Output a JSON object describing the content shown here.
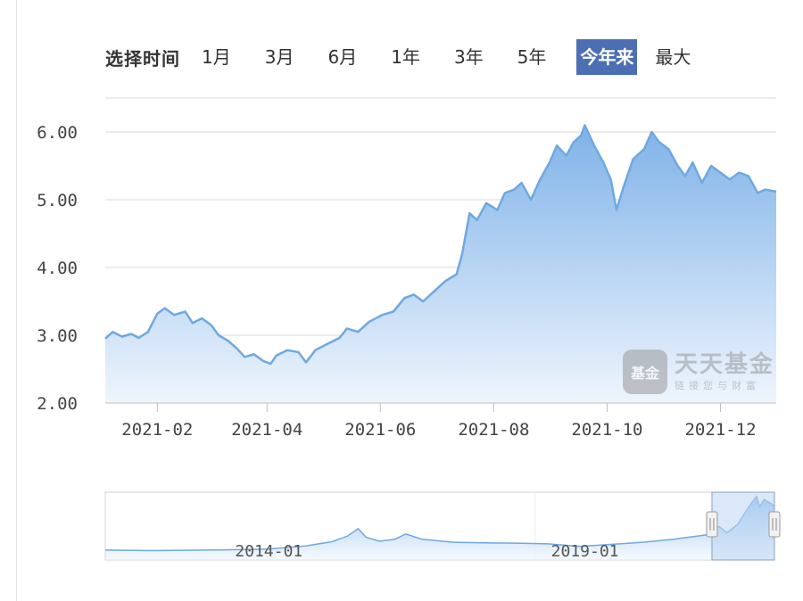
{
  "range_selector": {
    "label": "选择时间",
    "options": [
      {
        "id": "1m",
        "label": "1月"
      },
      {
        "id": "3m",
        "label": "3月"
      },
      {
        "id": "6m",
        "label": "6月"
      },
      {
        "id": "1y",
        "label": "1年"
      },
      {
        "id": "3y",
        "label": "3年"
      },
      {
        "id": "5y",
        "label": "5年"
      },
      {
        "id": "ytd",
        "label": "今年来"
      },
      {
        "id": "max",
        "label": "最大"
      }
    ],
    "active": "ytd"
  },
  "watermark": {
    "logo_text": "基金",
    "name": "天天基金",
    "slogan": "链接您与财富"
  },
  "colors": {
    "line": "#6fa8e0",
    "fill_top": "#7fb2e8",
    "fill_bottom": "#eef5fd",
    "active_btn": "#4c6fb3",
    "grid": "#d9d9d9"
  },
  "chart_data": {
    "type": "area",
    "title": "",
    "xlabel": "",
    "ylabel": "",
    "ylim": [
      2.0,
      6.5
    ],
    "yticks": [
      2.0,
      3.0,
      4.0,
      5.0,
      6.0
    ],
    "ytick_labels": [
      "2.00",
      "3.00",
      "4.00",
      "5.00",
      "6.00"
    ],
    "xlim": [
      "2021-01-04",
      "2021-12-31"
    ],
    "xticks": [
      "2021-02-01",
      "2021-04-01",
      "2021-06-01",
      "2021-08-01",
      "2021-10-01",
      "2021-12-01"
    ],
    "xtick_labels": [
      "2021-02",
      "2021-04",
      "2021-06",
      "2021-08",
      "2021-10",
      "2021-12"
    ],
    "grid": true,
    "series": [
      {
        "points": [
          [
            "2021-01-04",
            2.95
          ],
          [
            "2021-01-08",
            3.05
          ],
          [
            "2021-01-13",
            2.98
          ],
          [
            "2021-01-18",
            3.02
          ],
          [
            "2021-01-22",
            2.96
          ],
          [
            "2021-01-27",
            3.05
          ],
          [
            "2021-02-01",
            3.32
          ],
          [
            "2021-02-05",
            3.4
          ],
          [
            "2021-02-10",
            3.3
          ],
          [
            "2021-02-16",
            3.35
          ],
          [
            "2021-02-20",
            3.18
          ],
          [
            "2021-02-25",
            3.25
          ],
          [
            "2021-03-02",
            3.15
          ],
          [
            "2021-03-06",
            3.0
          ],
          [
            "2021-03-11",
            2.92
          ],
          [
            "2021-03-16",
            2.8
          ],
          [
            "2021-03-20",
            2.68
          ],
          [
            "2021-03-25",
            2.72
          ],
          [
            "2021-03-30",
            2.62
          ],
          [
            "2021-04-03",
            2.58
          ],
          [
            "2021-04-06",
            2.7
          ],
          [
            "2021-04-12",
            2.78
          ],
          [
            "2021-04-18",
            2.75
          ],
          [
            "2021-04-22",
            2.6
          ],
          [
            "2021-04-27",
            2.78
          ],
          [
            "2021-05-04",
            2.88
          ],
          [
            "2021-05-10",
            2.96
          ],
          [
            "2021-05-14",
            3.1
          ],
          [
            "2021-05-20",
            3.05
          ],
          [
            "2021-05-26",
            3.2
          ],
          [
            "2021-06-02",
            3.3
          ],
          [
            "2021-06-08",
            3.35
          ],
          [
            "2021-06-14",
            3.55
          ],
          [
            "2021-06-19",
            3.6
          ],
          [
            "2021-06-24",
            3.5
          ],
          [
            "2021-06-30",
            3.65
          ],
          [
            "2021-07-06",
            3.8
          ],
          [
            "2021-07-12",
            3.9
          ],
          [
            "2021-07-15",
            4.2
          ],
          [
            "2021-07-19",
            4.8
          ],
          [
            "2021-07-23",
            4.7
          ],
          [
            "2021-07-28",
            4.95
          ],
          [
            "2021-08-03",
            4.85
          ],
          [
            "2021-08-07",
            5.1
          ],
          [
            "2021-08-12",
            5.15
          ],
          [
            "2021-08-16",
            5.25
          ],
          [
            "2021-08-21",
            5.0
          ],
          [
            "2021-08-26",
            5.3
          ],
          [
            "2021-08-31",
            5.55
          ],
          [
            "2021-09-04",
            5.8
          ],
          [
            "2021-09-09",
            5.65
          ],
          [
            "2021-09-13",
            5.85
          ],
          [
            "2021-09-17",
            5.95
          ],
          [
            "2021-09-19",
            6.1
          ],
          [
            "2021-09-24",
            5.8
          ],
          [
            "2021-09-29",
            5.55
          ],
          [
            "2021-10-03",
            5.3
          ],
          [
            "2021-10-06",
            4.85
          ],
          [
            "2021-10-10",
            5.2
          ],
          [
            "2021-10-15",
            5.6
          ],
          [
            "2021-10-21",
            5.75
          ],
          [
            "2021-10-25",
            6.0
          ],
          [
            "2021-10-29",
            5.85
          ],
          [
            "2021-11-03",
            5.75
          ],
          [
            "2021-11-08",
            5.5
          ],
          [
            "2021-11-12",
            5.35
          ],
          [
            "2021-11-16",
            5.55
          ],
          [
            "2021-11-21",
            5.25
          ],
          [
            "2021-11-26",
            5.5
          ],
          [
            "2021-12-01",
            5.4
          ],
          [
            "2021-12-06",
            5.3
          ],
          [
            "2021-12-11",
            5.4
          ],
          [
            "2021-12-16",
            5.35
          ],
          [
            "2021-12-21",
            5.1
          ],
          [
            "2021-12-25",
            5.15
          ],
          [
            "2021-12-31",
            5.12
          ]
        ]
      }
    ],
    "navigator": {
      "xlim": [
        "2011-06-01",
        "2021-12-31"
      ],
      "ylim": [
        0.0,
        6.5
      ],
      "xtick_labels": [
        {
          "date": "2014-01-01",
          "label": "2014-01"
        },
        {
          "date": "2019-01-01",
          "label": "2019-01"
        }
      ],
      "selection": [
        "2021-01-04",
        "2021-12-31"
      ],
      "points": [
        [
          "2011-06-01",
          0.95
        ],
        [
          "2012-03-01",
          0.9
        ],
        [
          "2013-01-01",
          0.95
        ],
        [
          "2013-09-01",
          1.0
        ],
        [
          "2014-01-01",
          1.05
        ],
        [
          "2014-08-01",
          1.35
        ],
        [
          "2015-01-01",
          1.75
        ],
        [
          "2015-04-01",
          2.3
        ],
        [
          "2015-06-01",
          3.0
        ],
        [
          "2015-07-15",
          2.2
        ],
        [
          "2015-10-01",
          1.8
        ],
        [
          "2016-01-01",
          2.0
        ],
        [
          "2016-03-01",
          2.5
        ],
        [
          "2016-06-01",
          2.0
        ],
        [
          "2016-12-01",
          1.7
        ],
        [
          "2017-06-01",
          1.65
        ],
        [
          "2018-01-01",
          1.6
        ],
        [
          "2018-06-01",
          1.55
        ],
        [
          "2018-12-01",
          1.3
        ],
        [
          "2019-06-01",
          1.5
        ],
        [
          "2019-12-01",
          1.7
        ],
        [
          "2020-06-01",
          2.0
        ],
        [
          "2020-12-01",
          2.4
        ],
        [
          "2021-01-04",
          2.95
        ],
        [
          "2021-02-15",
          3.2
        ],
        [
          "2021-04-01",
          2.6
        ],
        [
          "2021-06-01",
          3.4
        ],
        [
          "2021-08-01",
          5.0
        ],
        [
          "2021-09-19",
          6.1
        ],
        [
          "2021-10-06",
          5.1
        ],
        [
          "2021-11-01",
          5.8
        ],
        [
          "2021-12-31",
          5.2
        ]
      ]
    }
  }
}
